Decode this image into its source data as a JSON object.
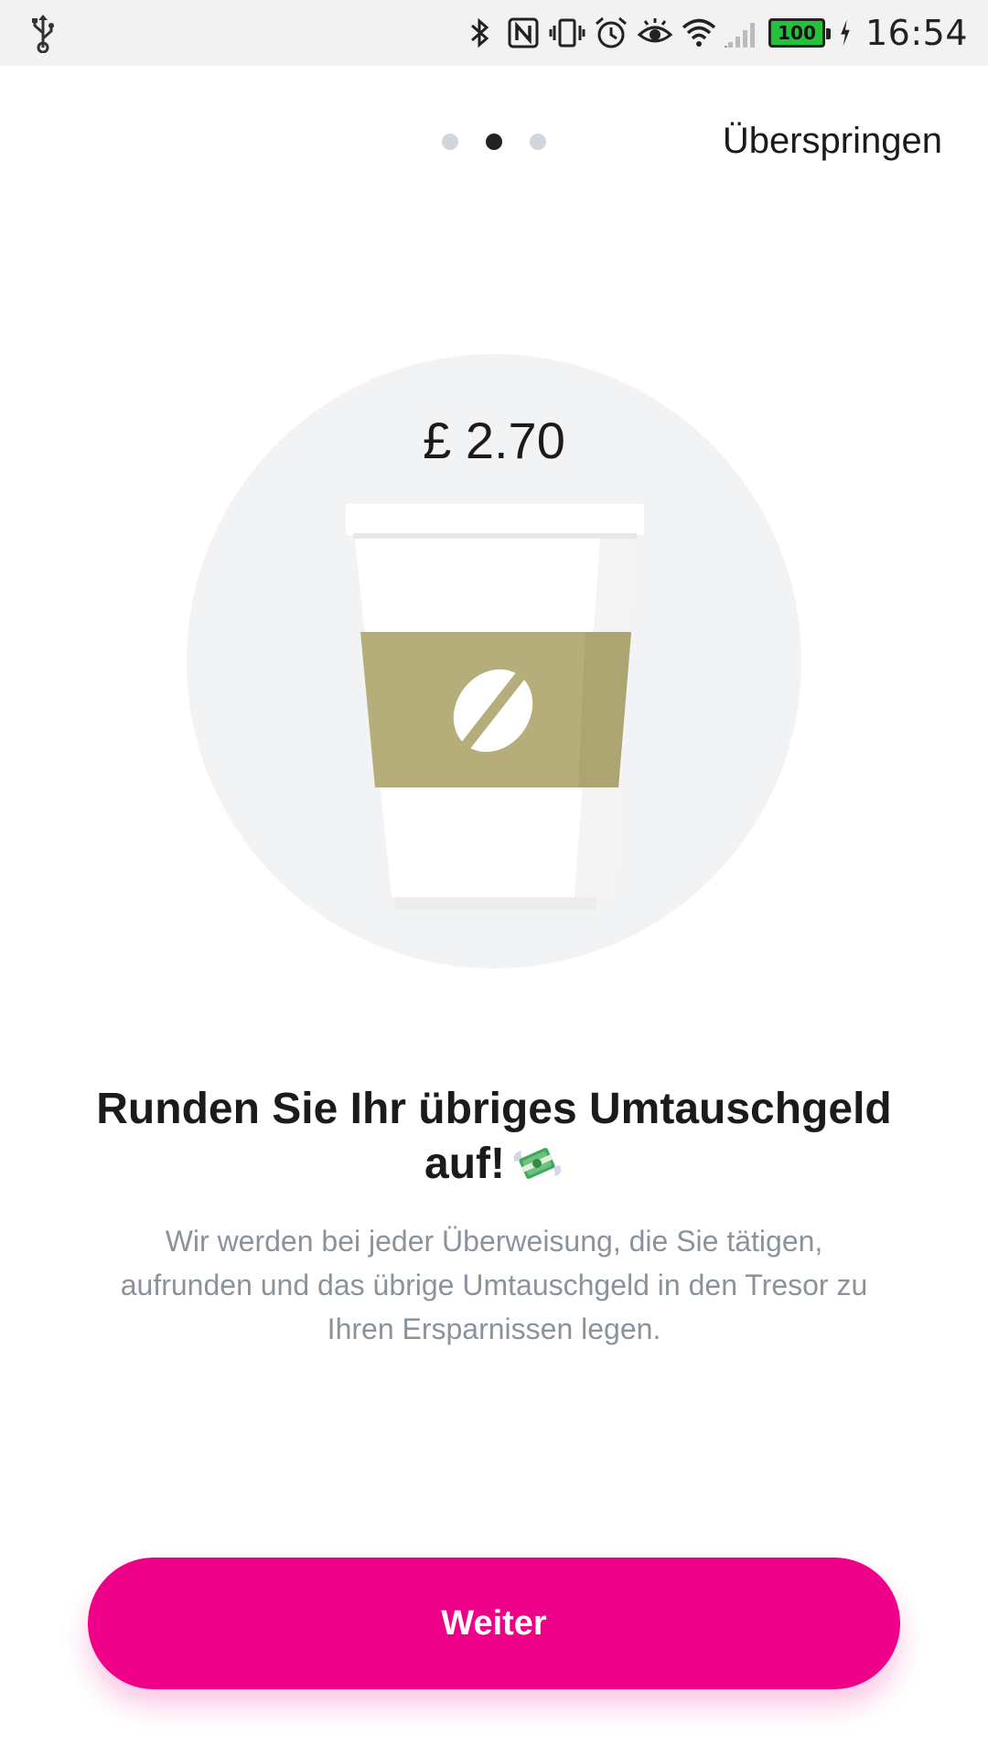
{
  "status_bar": {
    "time": "16:54",
    "battery_level": "100",
    "icons": [
      "usb-icon",
      "bluetooth-icon",
      "nfc-icon",
      "vibrate-icon",
      "alarm-icon",
      "eye-icon",
      "wifi-icon",
      "signal-icon",
      "battery-icon",
      "charging-icon"
    ]
  },
  "pager": {
    "total": 3,
    "active_index": 1
  },
  "header": {
    "skip_label": "Überspringen"
  },
  "illustration": {
    "price": "£ 2.70",
    "icon": "coffee-cup-icon",
    "colors": {
      "circle": "#f2f3f5",
      "sleeve": "#b6ae7a",
      "cup": "#ffffff"
    }
  },
  "content": {
    "headline": "Runden Sie Ihr übriges Umtauschgeld auf!",
    "headline_emoji_icon": "money-with-wings-icon",
    "description": "Wir werden bei jeder Überweisung, die Sie tätigen, aufrunden und das übrige Umtauschgeld in den Tresor zu Ihren Ersparnissen legen."
  },
  "actions": {
    "continue_label": "Weiter"
  },
  "colors": {
    "accent": "#ee0089",
    "text": "#1b1b1b",
    "muted": "#8a939b"
  }
}
